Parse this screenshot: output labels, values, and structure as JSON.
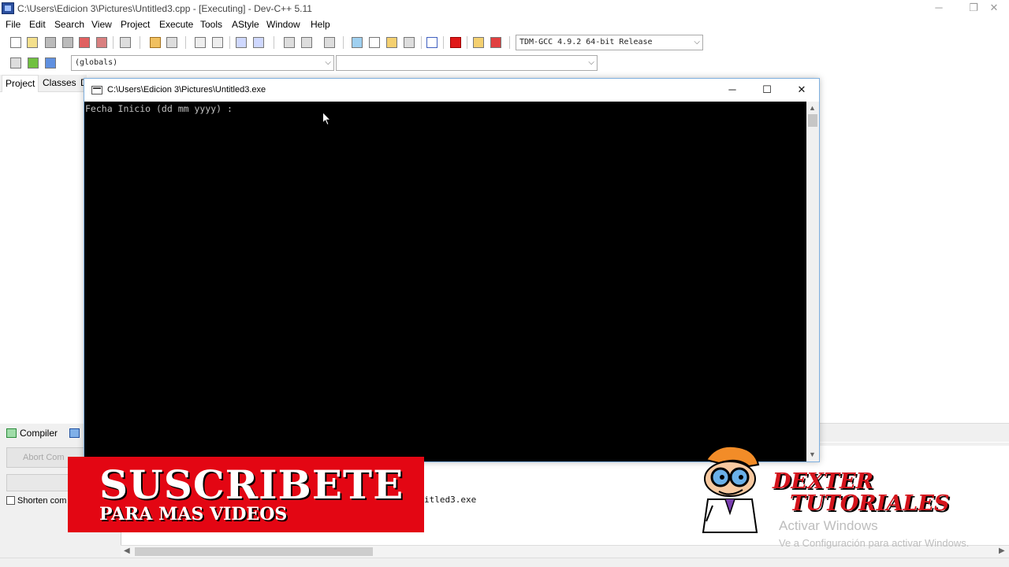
{
  "ide": {
    "window_title": "C:\\Users\\Edicion 3\\Pictures\\Untitled3.cpp - [Executing] - Dev-C++ 5.11",
    "minimize": "─",
    "restore": "❐",
    "close": "✕"
  },
  "menu": [
    "File",
    "Edit",
    "Search",
    "View",
    "Project",
    "Execute",
    "Tools",
    "AStyle",
    "Window",
    "Help"
  ],
  "toolbar": {
    "compiler_select": "TDM-GCC 4.9.2 64-bit Release",
    "scope_select": "(globals)",
    "member_select": ""
  },
  "left_panel": {
    "tabs": [
      "Project",
      "Classes",
      "D"
    ]
  },
  "bottom_panel": {
    "tabs": [
      "Compiler",
      ""
    ],
    "abort_button": "Abort Com",
    "shorten_label": "Shorten com",
    "log_line": "itled3.exe"
  },
  "console": {
    "title": "C:\\Users\\Edicion 3\\Pictures\\Untitled3.exe",
    "minimize": "─",
    "maximize": "☐",
    "close": "✕",
    "output": "Fecha Inicio (dd mm yyyy) :"
  },
  "overlay": {
    "subscribe_big": "SUSCRIBETE",
    "subscribe_small": "PARA MAS VIDEOS",
    "brand_line1": "DEXTER",
    "brand_line2": "TUTORIALES",
    "activate_title": "Activar Windows",
    "activate_sub": "Ve a Configuración para activar Windows."
  },
  "colors": {
    "banner_red": "#e30613",
    "brand_red": "#d4141c",
    "console_bg": "#000000",
    "console_text": "#c0c0c0"
  }
}
